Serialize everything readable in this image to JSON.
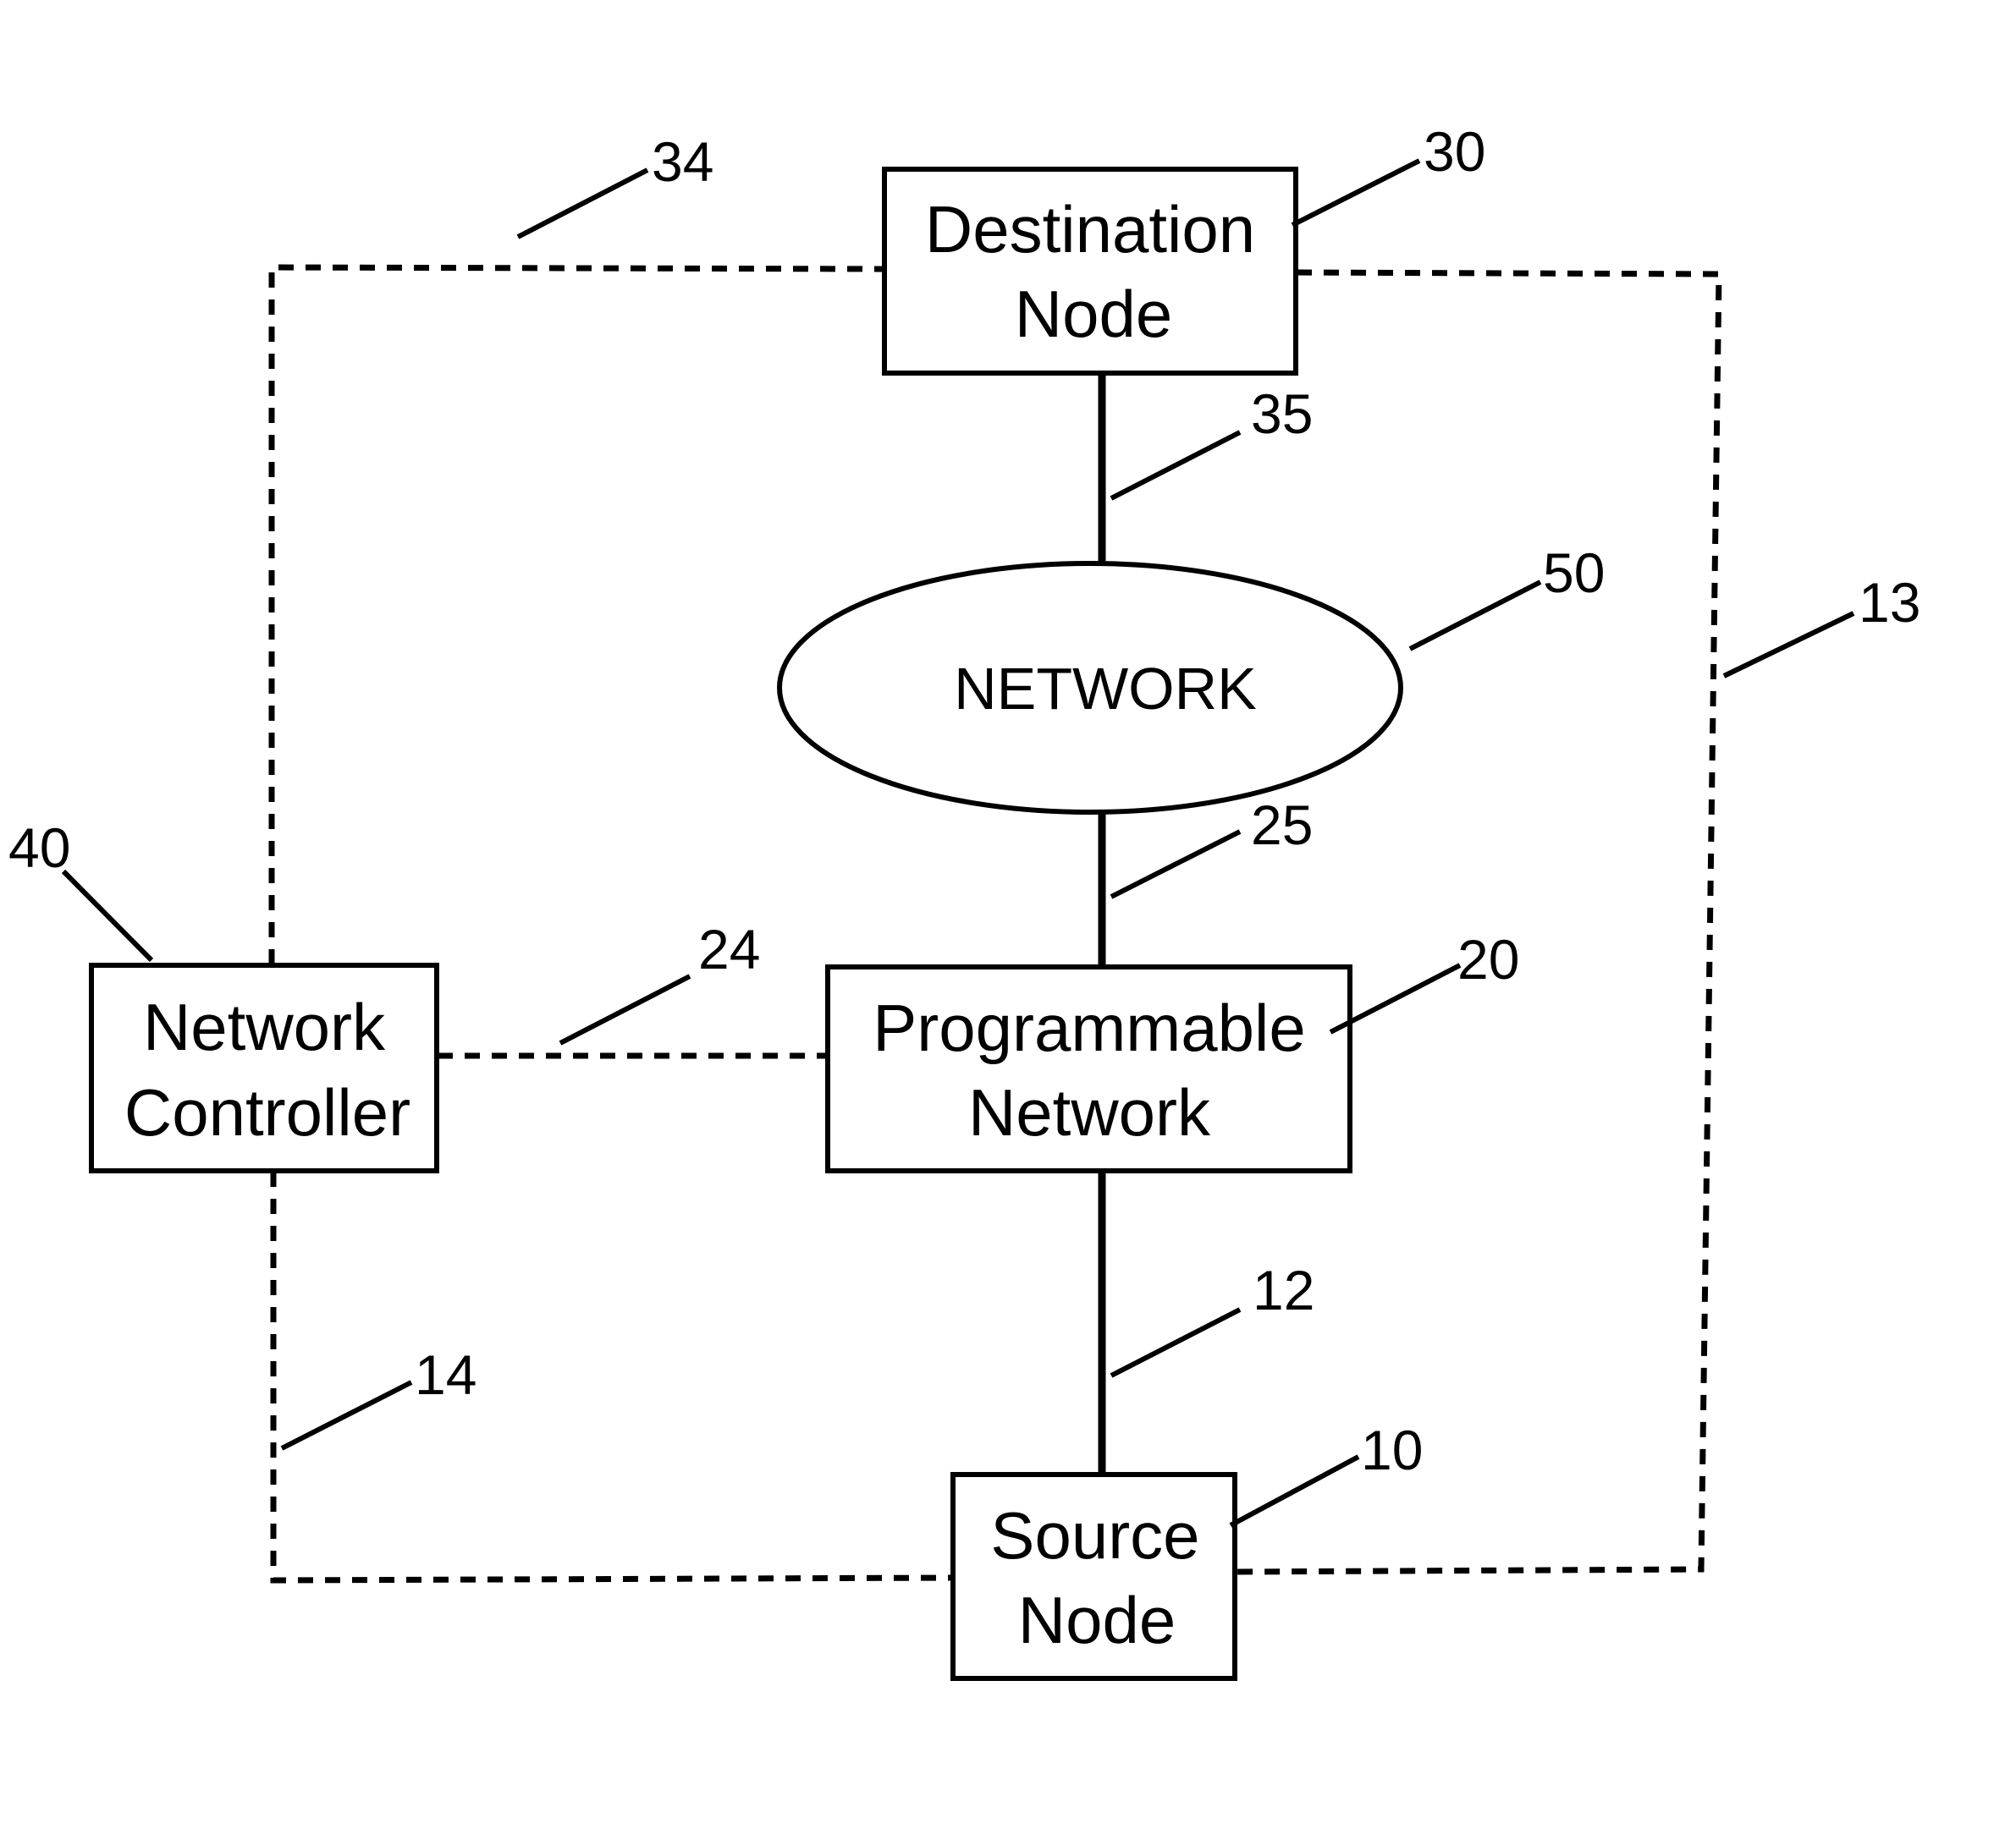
{
  "diagram": {
    "nodes": {
      "destination": {
        "line1": "Destination",
        "line2": "Node",
        "ref": "30"
      },
      "network": {
        "label": "NETWORK",
        "ref": "50"
      },
      "programmable": {
        "line1": "Programmable",
        "line2": "Network",
        "ref": "20"
      },
      "source": {
        "line1": "Source",
        "line2": "Node",
        "ref": "10"
      },
      "controller": {
        "line1": "Network",
        "line2": "Controller",
        "ref": "40"
      }
    },
    "links": {
      "dest_to_network": {
        "ref": "35",
        "style": "solid"
      },
      "network_to_programmable": {
        "ref": "25",
        "style": "solid"
      },
      "programmable_to_source": {
        "ref": "12",
        "style": "solid"
      },
      "controller_to_programmable": {
        "ref": "24",
        "style": "dashed"
      },
      "controller_to_destination": {
        "ref": "34",
        "style": "dashed"
      },
      "source_to_destination": {
        "ref": "13",
        "style": "dashed"
      },
      "controller_to_source": {
        "ref": "14",
        "style": "dashed"
      }
    }
  }
}
